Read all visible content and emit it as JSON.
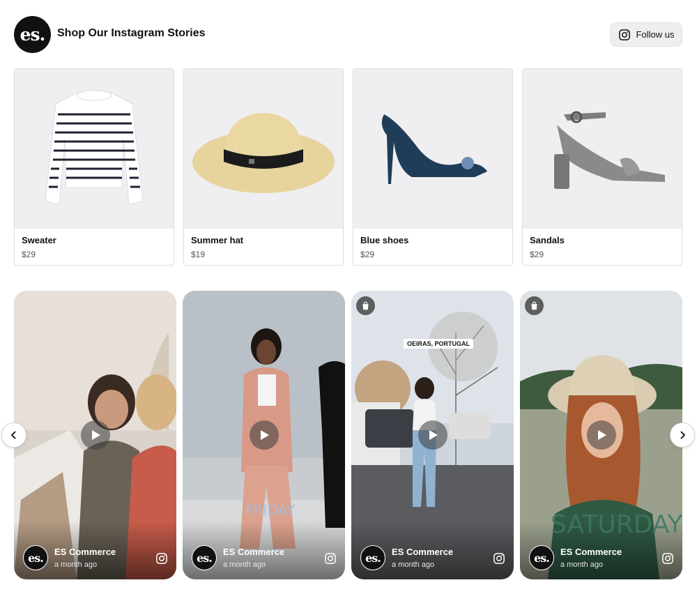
{
  "header": {
    "logo_text": "es.",
    "title": "Shop Our Instagram Stories",
    "follow_label": "Follow us"
  },
  "products": [
    {
      "name": "Sweater",
      "price": "$29"
    },
    {
      "name": "Summer hat",
      "price": "$19"
    },
    {
      "name": "Blue shoes",
      "price": "$29"
    },
    {
      "name": "Sandals",
      "price": "$29"
    }
  ],
  "stories": [
    {
      "author": "ES Commerce",
      "time": "a month ago",
      "avatar_text": "es."
    },
    {
      "author": "ES Commerce",
      "time": "a month ago",
      "avatar_text": "es.",
      "overlay": "FRIDAY"
    },
    {
      "author": "ES Commerce",
      "time": "a month ago",
      "avatar_text": "es.",
      "location": "OEIRAS, PORTUGAL"
    },
    {
      "author": "ES Commerce",
      "time": "a month ago",
      "avatar_text": "es.",
      "overlay": "SATURDAY"
    }
  ],
  "colors": {
    "brand": "#111111",
    "accent_overlay": "#a0bee6"
  },
  "icons": [
    "instagram-icon",
    "play-icon",
    "shopping-bag-icon",
    "chevron-left-icon",
    "chevron-right-icon"
  ]
}
